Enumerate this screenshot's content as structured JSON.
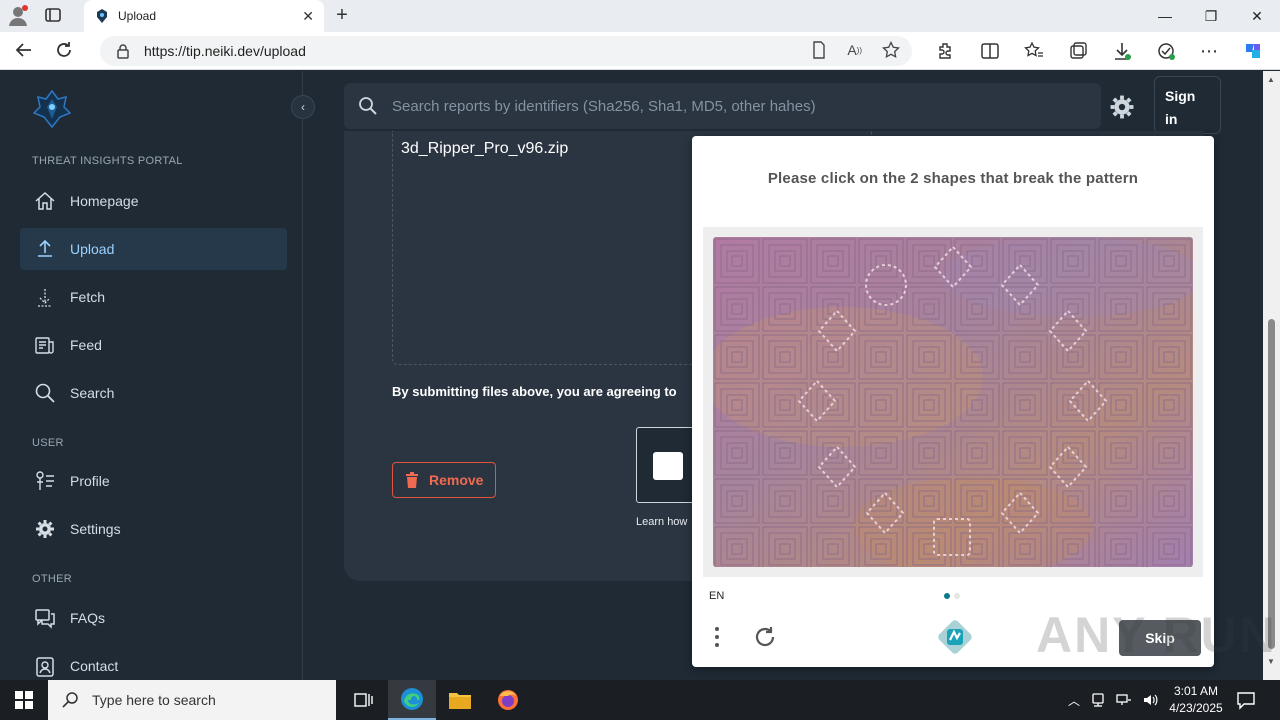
{
  "browser": {
    "tab_title": "Upload",
    "url": "https://tip.neiki.dev/upload"
  },
  "sidebar": {
    "section_portal": "THREAT INSIGHTS PORTAL",
    "section_user": "USER",
    "section_other": "OTHER",
    "items": [
      {
        "label": "Homepage",
        "icon": "home-icon"
      },
      {
        "label": "Upload",
        "icon": "upload-icon",
        "active": true
      },
      {
        "label": "Fetch",
        "icon": "download-icon"
      },
      {
        "label": "Feed",
        "icon": "feed-icon"
      },
      {
        "label": "Search",
        "icon": "search-icon"
      },
      {
        "label": "Profile",
        "icon": "profile-icon"
      },
      {
        "label": "Settings",
        "icon": "gear-icon"
      },
      {
        "label": "FAQs",
        "icon": "faq-icon"
      },
      {
        "label": "Contact",
        "icon": "contact-icon"
      }
    ]
  },
  "header": {
    "search_placeholder": "Search reports by identifiers (Sha256, Sha1, MD5, other hahes)",
    "signin_line1": "Sign",
    "signin_line2": "in"
  },
  "upload": {
    "filename": "3d_Ripper_Pro_v96.zip",
    "terms_text": "By submitting files above, you are agreeing to",
    "remove_label": "Remove",
    "learn_text": "Learn how"
  },
  "captcha": {
    "prompt": "Please click on the 2 shapes that break the pattern",
    "language": "EN",
    "skip_label": "Skip",
    "page_index": 1,
    "page_count": 2
  },
  "watermark": "ANY RUN",
  "taskbar": {
    "search_placeholder": "Type here to search",
    "time": "3:01 AM",
    "date": "4/23/2025"
  },
  "colors": {
    "app_bg": "#1f2a35",
    "card_bg": "#2a3541",
    "active_nav": "#26394a",
    "remove_red": "#e0533c",
    "captcha_accent": "#0a7a8a"
  }
}
